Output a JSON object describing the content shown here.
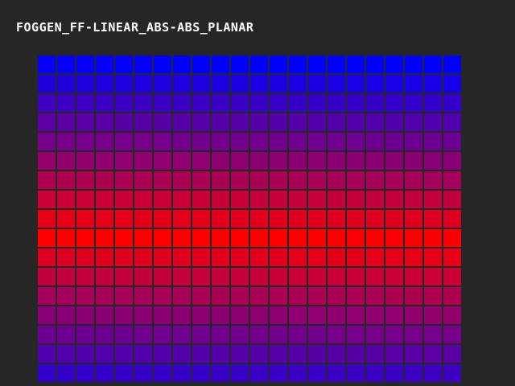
{
  "window": {
    "title": "FOGGEN_FF-LINEAR_ABS-ABS_PLANAR"
  },
  "fog_grid": {
    "columns": 22,
    "rows": 17,
    "near_color": "#ff0000",
    "far_color": "#0000ff",
    "peak_row": 9,
    "column_fog_offset": 0.04
  }
}
